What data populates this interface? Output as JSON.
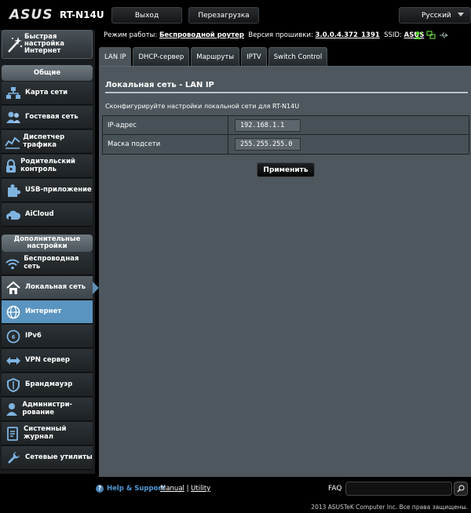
{
  "header": {
    "brand": "ASUS",
    "model": "RT-N14U",
    "logout_label": "Выход",
    "reboot_label": "Перезагрузка",
    "language": "Русский"
  },
  "status": {
    "mode_label": "Режим работы:",
    "mode_value": "Беспроводной роутер",
    "fw_label": "Версия прошивки:",
    "fw_value": "3.0.0.4.372_1391",
    "ssid_label": "SSID:",
    "ssid_value": "ASUS"
  },
  "sidebar": {
    "qis_label": "Быстрая настройка Интернет",
    "general_header": "Общие",
    "general_items": [
      {
        "label": "Карта сети",
        "icon": "network-map-icon"
      },
      {
        "label": "Гостевая сеть",
        "icon": "guest-network-icon"
      },
      {
        "label": "Диспетчер трафика",
        "icon": "traffic-manager-icon"
      },
      {
        "label": "Родительский контроль",
        "icon": "parental-control-icon"
      },
      {
        "label": "USB-приложение",
        "icon": "usb-app-icon"
      },
      {
        "label": "AiCloud",
        "icon": "aicloud-icon"
      }
    ],
    "advanced_header": "Дополнительные настройки",
    "advanced_items": [
      {
        "label": "Беспроводная сеть",
        "icon": "wireless-icon"
      },
      {
        "label": "Локальная сеть",
        "icon": "lan-icon"
      },
      {
        "label": "Интернет",
        "icon": "internet-icon"
      },
      {
        "label": "IPv6",
        "icon": "ipv6-icon"
      },
      {
        "label": "VPN сервер",
        "icon": "vpn-icon"
      },
      {
        "label": "Брандмауэр",
        "icon": "firewall-icon"
      },
      {
        "label": "Администри-рование",
        "icon": "administration-icon"
      },
      {
        "label": "Системный журнал",
        "icon": "system-log-icon"
      },
      {
        "label": "Сетевые утилиты",
        "icon": "network-tools-icon"
      }
    ]
  },
  "tabs": [
    "LAN IP",
    "DHCP-сервер",
    "Маршруты",
    "IPTV",
    "Switch Control"
  ],
  "main": {
    "title": "Локальная сеть - LAN IP",
    "description": "Сконфигурируйте настройки локальной сети для RT-N14U",
    "fields": [
      {
        "label": "IP-адрес",
        "value": "192.168.1.1"
      },
      {
        "label": "Маска подсети",
        "value": "255.255.255.0"
      }
    ],
    "apply_label": "Применить"
  },
  "footer": {
    "help_label": "Help & Support",
    "manual_label": "Manual",
    "sep": "|",
    "utility_label": "Utility",
    "faq_label": "FAQ",
    "copyright": "2013 ASUSTeK Computer Inc. Все права защищены."
  }
}
